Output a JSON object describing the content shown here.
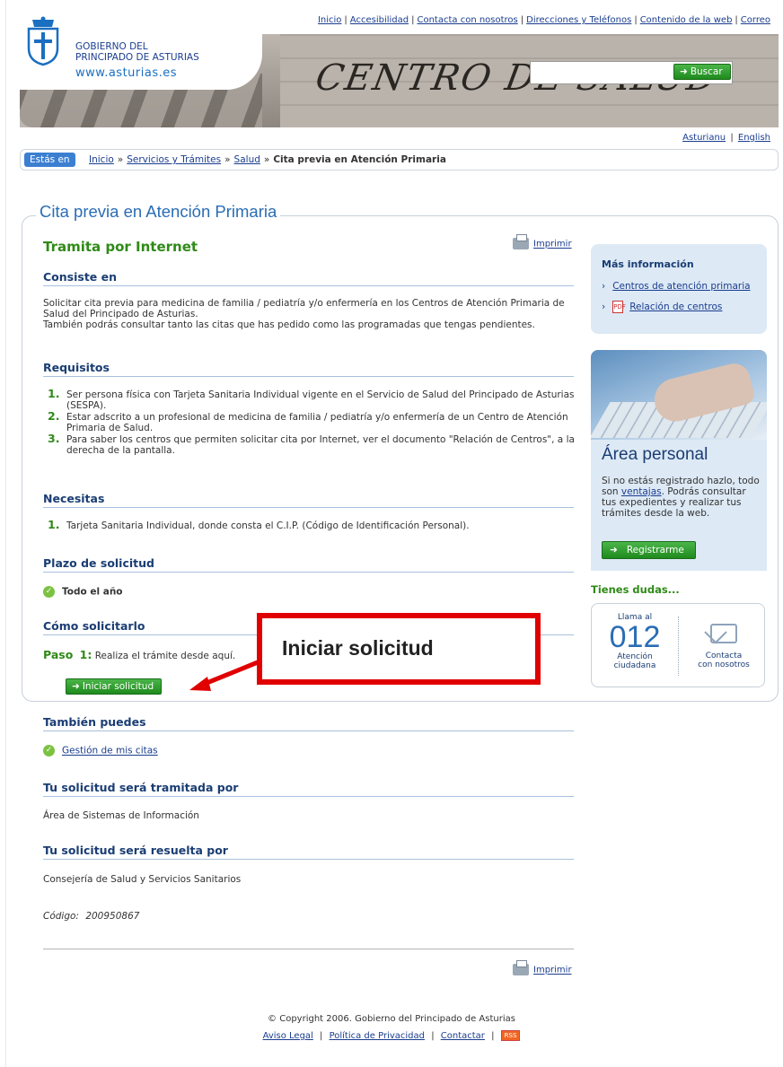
{
  "header": {
    "top_links": [
      "Inicio",
      "Accesibilidad",
      "Contacta con nosotros",
      "Direcciones y Teléfonos",
      "Contenido de la web",
      "Correo"
    ],
    "logo_line1": "GOBIERNO DEL",
    "logo_line2": "PRINCIPADO DE ASTURIAS",
    "logo_url": "www.asturias.es",
    "banner_sign": "CENTRO DE SALUD",
    "search_placeholder": "",
    "search_button": "Buscar",
    "languages": [
      "Asturianu",
      "English"
    ]
  },
  "breadcrumb": {
    "label": "Estás en",
    "items": [
      "Inicio",
      "Servicios y Trámites",
      "Salud"
    ],
    "current": "Cita previa en Atención Primaria"
  },
  "page_title": "Cita previa en Atención Primaria",
  "main": {
    "heading": "Tramita por Internet",
    "print": "Imprimir",
    "consiste_title": "Consiste en",
    "consiste_text1": "Solicitar cita previa para medicina de familia / pediatría y/o enfermería en los Centros de Atención Primaria de Salud del Principado de Asturias.",
    "consiste_text2": "También podrás consultar tanto las citas que has pedido como las programadas que tengas pendientes.",
    "requisitos_title": "Requisitos",
    "requisitos": [
      {
        "n": "1.",
        "text": "Ser persona física con Tarjeta Sanitaria Individual vigente en el Servicio de Salud del Principado de Asturias (SESPA)."
      },
      {
        "n": "2.",
        "text": "Estar adscrito a un profesional de medicina de familia / pediatría y/o enfermería de un Centro de Atención Primaria de Salud."
      },
      {
        "n": "3.",
        "text": "Para saber los centros que permiten solicitar cita por Internet, ver el documento \"Relación de Centros\", a la derecha de la pantalla."
      }
    ],
    "necesitas_title": "Necesitas",
    "necesitas": [
      {
        "n": "1.",
        "text": "Tarjeta Sanitaria Individual, donde consta el C.I.P. (Código de Identificación Personal)."
      }
    ],
    "plazo_title": "Plazo de solicitud",
    "plazo_value": "Todo el año",
    "como_title": "Cómo solicitarlo",
    "paso_label": "Paso",
    "paso_num": "1:",
    "paso_text": "Realiza el trámite desde aquí.",
    "iniciar_button": "Iniciar solicitud",
    "tambien_title": "También puedes",
    "tambien_link": "Gestión de mis citas",
    "tramitada_title": "Tu solicitud será tramitada por",
    "tramitada_value": "Área de Sistemas de Información",
    "resuelta_title": "Tu solicitud será resuelta por",
    "resuelta_value": "Consejería de Salud y Servicios Sanitarios",
    "codigo_label": "Código:",
    "codigo_value": "200950867"
  },
  "sidebar": {
    "info_title": "Más información",
    "info_links": [
      "Centros de atención primaria",
      "Relación de centros"
    ],
    "area_title": "Área personal",
    "area_text_before": "Si no estás registrado hazlo, todo son",
    "area_link": "ventajas",
    "area_text_after": ". Podrás consultar tus expedientes y realizar tus trámites desde la web.",
    "register_button": "Registrarme",
    "dudas_title": "Tienes dudas...",
    "llama_al": "Llama al",
    "phone": "012",
    "phone_caption1": "Atención",
    "phone_caption2": "ciudadana",
    "contact_caption1": "Contacta",
    "contact_caption2": "con nosotros"
  },
  "annotation": {
    "label": "Iniciar solicitud",
    "color": "#e00000"
  },
  "footer": {
    "copyright": "© Copyright 2006. Gobierno del Principado de Asturias",
    "links": [
      "Aviso Legal",
      "Política de Privacidad",
      "Contactar"
    ],
    "rss": "RSS"
  },
  "colors": {
    "brand_blue": "#1a3d73",
    "link": "#1a3d8f",
    "green": "#2f8a18",
    "button_green": "#1f8a1d"
  }
}
